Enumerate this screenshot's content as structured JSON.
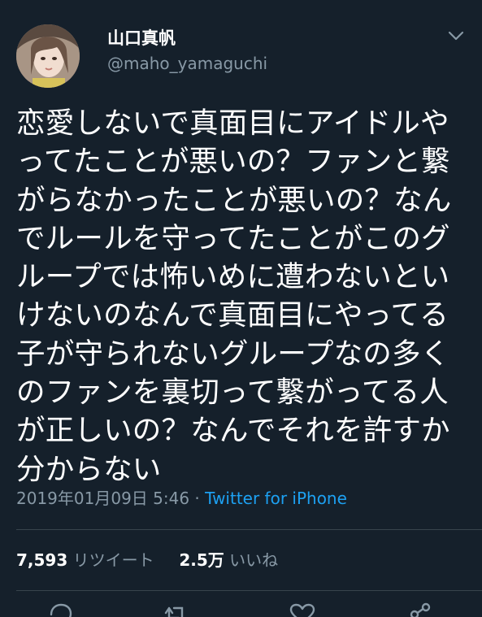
{
  "user": {
    "display_name": "山口真帆",
    "handle": "@maho_yamaguchi"
  },
  "tweet": {
    "text": "恋愛しないで真面目にアイドルやってたことが悪いの？ファンと繋がらなかったことが悪いの？なんでルールを守ってたことがこのグループでは怖いめに遭わないといけないのなんで真面目にやってる子が守られないグループなの多くのファンを裏切って繋がってる人が正しいの？なんでそれを許すか分からない",
    "timestamp": "2019年01月09日 5:46",
    "separator": " · ",
    "source": "Twitter for iPhone"
  },
  "stats": {
    "retweet_count": "7,593",
    "retweet_label": "リツイート",
    "like_count": "2.5万",
    "like_label": "いいね"
  },
  "icons": {
    "avatar": "avatar-photo",
    "menu": "chevron-down-icon",
    "reply": "reply-icon",
    "retweet": "retweet-icon",
    "like": "heart-icon",
    "share": "share-icon"
  },
  "colors": {
    "background": "#15202b",
    "text": "#ffffff",
    "secondary": "#8899a6",
    "link": "#1da1f2",
    "divider": "#38444d"
  }
}
